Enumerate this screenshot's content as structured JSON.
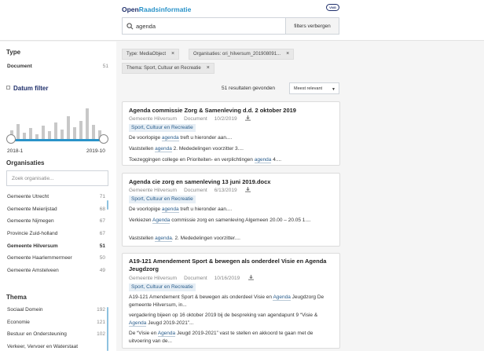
{
  "header": {
    "brand_part1": "Open",
    "brand_part2": "Raadsinformatie",
    "badge": "VNG",
    "search_value": "agenda",
    "filters_button": "filters verbergen"
  },
  "sidebar": {
    "type_title": "Type",
    "type_items": [
      {
        "label": "Document",
        "count": "51"
      }
    ],
    "date_filter_title": "Datum filter",
    "date_start": "2018-1",
    "date_end": "2019-10",
    "org_title": "Organisaties",
    "org_search_placeholder": "Zoek organisatie...",
    "org_items": [
      {
        "label": "Gemeente Utrecht",
        "count": "71"
      },
      {
        "label": "Gemeente Meierijstad",
        "count": "68"
      },
      {
        "label": "Gemeente Nijmegen",
        "count": "67"
      },
      {
        "label": "Provincie Zuid-holland",
        "count": "67"
      },
      {
        "label": "Gemeente Hilversum",
        "count": "51"
      },
      {
        "label": "Gemeente Haarlemmermeer",
        "count": "50"
      },
      {
        "label": "Gemeente Amstelveen",
        "count": "49"
      }
    ],
    "theme_title": "Thema",
    "theme_items": [
      {
        "label": "Sociaal Domein",
        "count": "192"
      },
      {
        "label": "Economie",
        "count": "121"
      },
      {
        "label": "Bestuur en Ondersteuning",
        "count": "102"
      },
      {
        "label": "Verkeer, Vervoer en Waterstaat",
        "count": ""
      }
    ]
  },
  "filters": {
    "chips": [
      "Type: MediaObject",
      "Organisaties: ori_hilversum_201908091...",
      "Thema: Sport, Cultuur en Recreatie"
    ],
    "close_glyph": "×"
  },
  "results": {
    "count_text": "51 resultaten gevonden",
    "sort_label": "Meest relevant",
    "items": [
      {
        "title": "Agenda commissie Zorg & Samenleving d.d. 2 oktober 2019",
        "org": "Gemeente Hilversum",
        "kind": "Document",
        "date": "10/2/2019",
        "tag": "Sport, Cultuur en Recreatie",
        "s1a": "De voorlopige ",
        "s1h": "agenda",
        "s1b": " treft u hieronder aan....",
        "s2a": "Vaststellen ",
        "s2h": "agenda",
        "s2b": " 2. Mededelingen voorzitter 3....",
        "s3a": "Toezeggingen college en Prioriteiten- en verplichtingen ",
        "s3h": "agenda",
        "s3b": " 4...."
      },
      {
        "title": "Agenda cie zorg en samenleving 13 juni 2019.docx",
        "org": "Gemeente Hilversum",
        "kind": "Document",
        "date": "6/13/2019",
        "tag": "Sport, Cultuur en Recreatie",
        "s1a": "De voorlopige ",
        "s1h": "agenda",
        "s1b": " treft u hieronder aan....",
        "s2a": "Verkiezen ",
        "s2h": "Agenda",
        "s2b": " commissie zorg en samenleving Algemeen 20.00 – 20.05 1....",
        "s3a": "Vaststellen ",
        "s3h": "agenda",
        "s3b": ". 2. Mededelingen voorzitter...."
      },
      {
        "title": "A19-121 Amendement Sport & bewegen als onderdeel Visie en Agenda Jeugdzorg",
        "org": "Gemeente Hilversum",
        "kind": "Document",
        "date": "10/16/2019",
        "tag": "Sport, Cultuur en Recreatie",
        "s1a": "A19-121 Amendement Sport & bewegen als onderdeel Visie en ",
        "s1h": "Agenda",
        "s1b": " Jeugdzorg De gemeente Hilversum, in...",
        "s2a": "vergadering bijeen op 16 oktober 2019 bij de bespreking van agendapunt 9 “Visie & ",
        "s2h": "Agenda",
        "s2b": " Jeugd 2019-2021”...",
        "s3a": "De “Visie en ",
        "s3h": "Agenda",
        "s3b": " Jeugd 2019-2021” vast te stellen en akkoord te gaan met de uitvoering van de..."
      }
    ]
  }
}
